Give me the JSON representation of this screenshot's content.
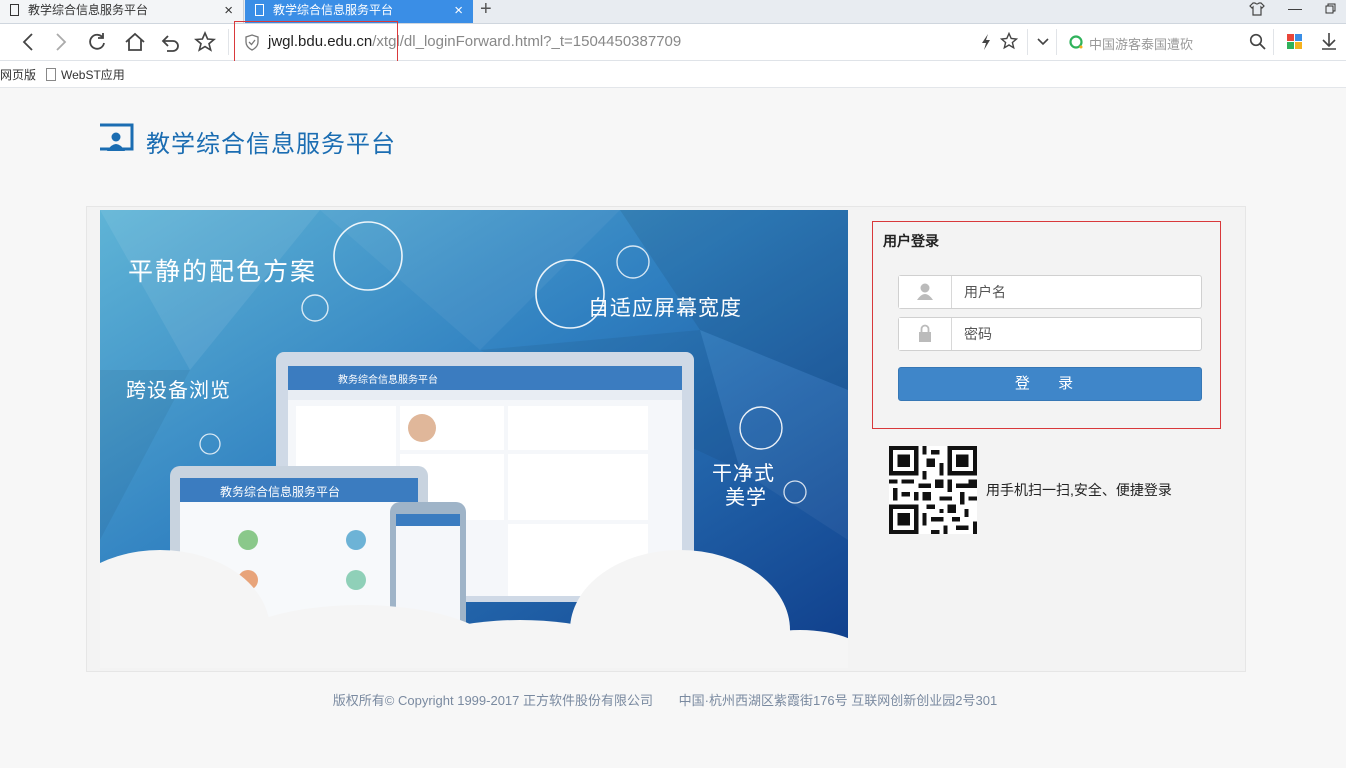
{
  "browser": {
    "tabs": [
      {
        "title": "教学综合信息服务平台",
        "active": false
      },
      {
        "title": "教学综合信息服务平台",
        "active": true
      }
    ],
    "new_tab_icon": "plus",
    "address": {
      "domain": "jwgl.bdu.edu.cn",
      "path": "/xtgl/dl_loginForward.html?_t=1504450387709"
    },
    "search_placeholder": "中国游客泰国遭砍",
    "bookmarks": [
      "网页版",
      "WebST应用"
    ]
  },
  "page": {
    "logo_text": "教学综合信息服务平台",
    "banner": {
      "lines": [
        "平静的配色方案",
        "自适应屏幕宽度",
        "跨设备浏览",
        "干净式",
        "美学"
      ],
      "mock_title": "教务综合信息服务平台"
    },
    "login": {
      "title": "用户登录",
      "username_placeholder": "用户名",
      "password_placeholder": "密码",
      "submit_label": "登 录"
    },
    "qr_text": "用手机扫一扫,安全、便捷登录",
    "footer": {
      "copyright": "版权所有© Copyright 1999-2017 正方软件股份有限公司",
      "address": "中国·杭州西湖区紫霞街176号 互联网创新创业园2号301"
    },
    "colors": {
      "brand": "#1b6db2",
      "button": "#3f86c9",
      "highlight": "#d8383a",
      "tab_active": "#3a8ee6"
    }
  }
}
